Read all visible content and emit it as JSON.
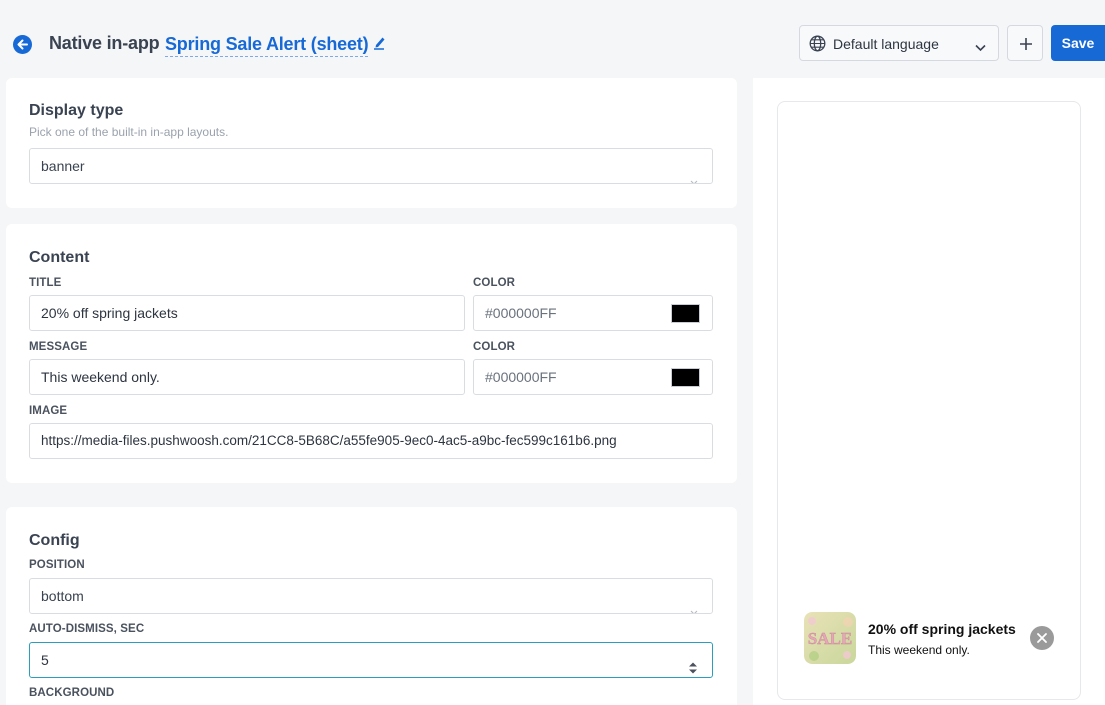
{
  "header": {
    "page_title": "Native in-app",
    "campaign_name": "Spring Sale Alert (sheet)",
    "language": "Default language",
    "save_label": "Save"
  },
  "display_type": {
    "title": "Display type",
    "subtitle": "Pick one of the built-in in-app layouts.",
    "value": "banner"
  },
  "content": {
    "title": "Content",
    "title_label": "TITLE",
    "title_value": "20% off spring jackets",
    "title_color_label": "COLOR",
    "title_color": "#000000FF",
    "message_label": "MESSAGE",
    "message_value": "This weekend only.",
    "message_color_label": "COLOR",
    "message_color": "#000000FF",
    "image_label": "IMAGE",
    "image_value": "https://media-files.pushwoosh.com/21CC8-5B68C/a55fe905-9ec0-4ac5-a9bc-fec599c161b6.png"
  },
  "config": {
    "title": "Config",
    "position_label": "POSITION",
    "position_value": "bottom",
    "auto_dismiss_label": "AUTO-DISMISS, SEC",
    "auto_dismiss_value": "5",
    "background_label": "BACKGROUND"
  },
  "preview": {
    "title": "20% off spring jackets",
    "message": "This weekend only.",
    "image_text": "SALE"
  },
  "colors": {
    "accent": "#1769d6",
    "focus_border": "#2c9dbc",
    "swatch": "#000000"
  },
  "icons": [
    "back-arrow-icon",
    "pencil-icon",
    "globe-icon",
    "chevron-down-icon",
    "plus-icon",
    "stepper-icon",
    "close-icon"
  ]
}
